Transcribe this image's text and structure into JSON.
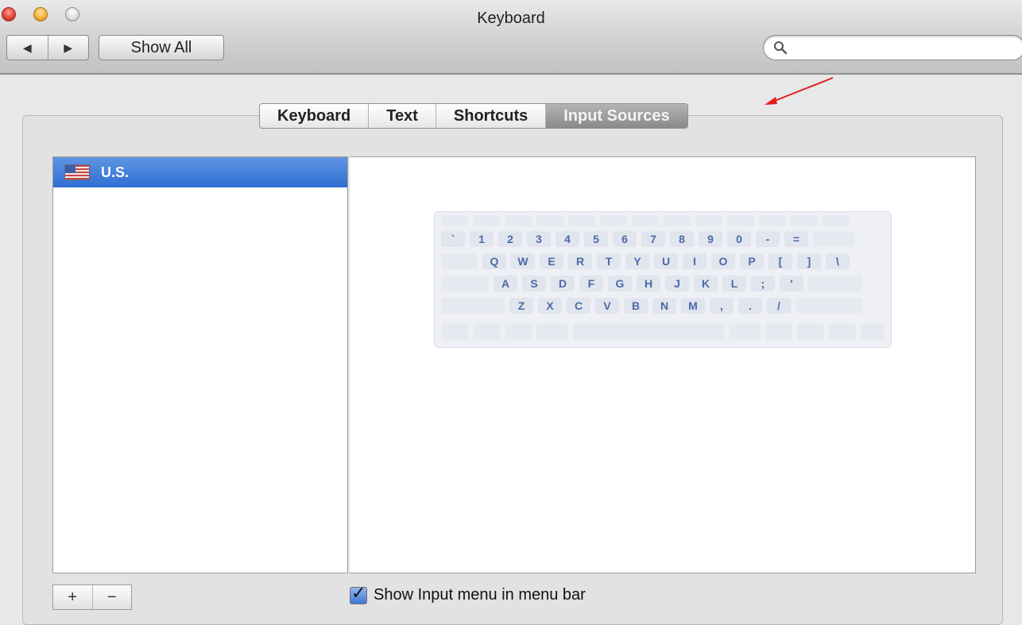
{
  "window": {
    "title": "Keyboard"
  },
  "toolbar": {
    "back_glyph": "◀",
    "forward_glyph": "▶",
    "show_all_label": "Show All",
    "search": {
      "value": "",
      "placeholder": ""
    }
  },
  "tabs": [
    {
      "label": "Keyboard",
      "selected": false
    },
    {
      "label": "Text",
      "selected": false
    },
    {
      "label": "Shortcuts",
      "selected": false
    },
    {
      "label": "Input Sources",
      "selected": true
    }
  ],
  "sources": [
    {
      "label": "U.S.",
      "selected": true,
      "icon": "us-flag-icon"
    }
  ],
  "keyboard": {
    "rows": [
      [
        "`",
        "1",
        "2",
        "3",
        "4",
        "5",
        "6",
        "7",
        "8",
        "9",
        "0",
        "-",
        "="
      ],
      [
        "Q",
        "W",
        "E",
        "R",
        "T",
        "Y",
        "U",
        "I",
        "O",
        "P",
        "[",
        "]",
        "\\"
      ],
      [
        "A",
        "S",
        "D",
        "F",
        "G",
        "H",
        "J",
        "K",
        "L",
        ";",
        "'"
      ],
      [
        "Z",
        "X",
        "C",
        "V",
        "B",
        "N",
        "M",
        ",",
        ".",
        "/"
      ]
    ]
  },
  "bottom": {
    "add_label": "+",
    "remove_label": "−",
    "show_input_menu": {
      "label": "Show Input menu in menu bar",
      "checked": true
    }
  },
  "colors": {
    "selection": "#2f6fd3",
    "key_text": "#4b6aa6",
    "annotation_arrow": "#e02020"
  }
}
